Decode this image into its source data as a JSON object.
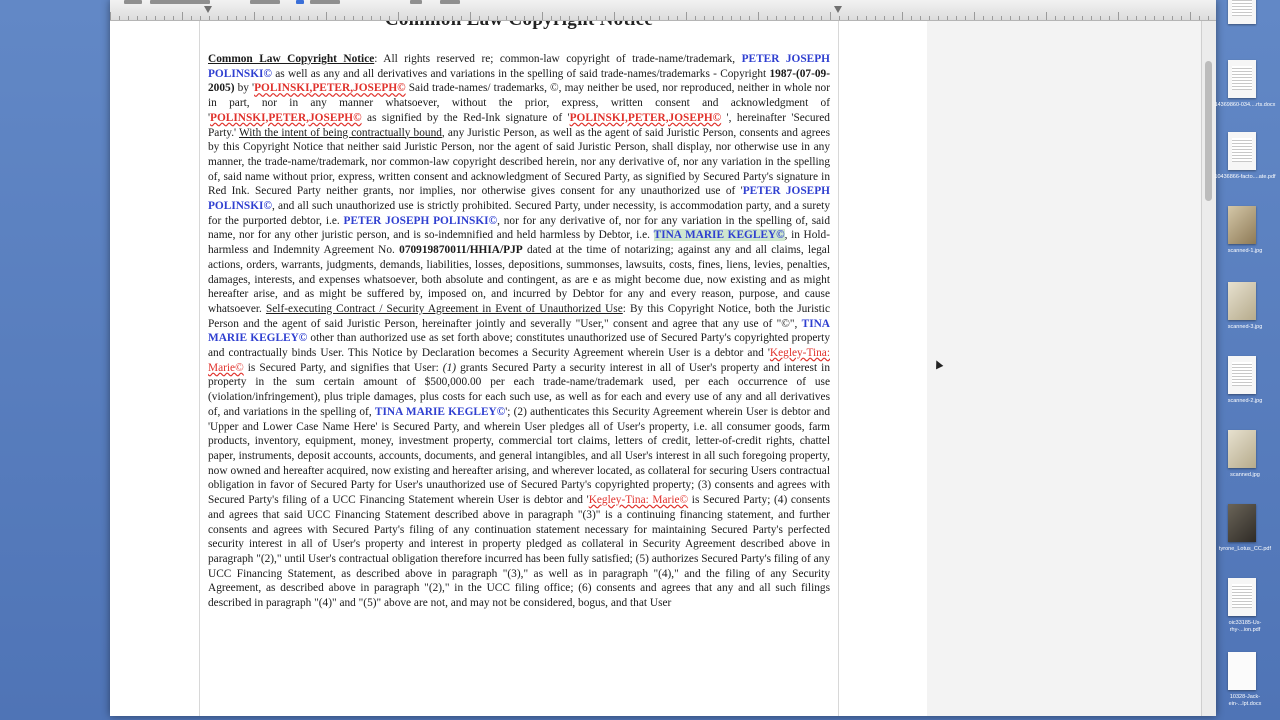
{
  "window": {
    "page_heading": "Common Law Copyright Notice"
  },
  "document": {
    "segments": [
      {
        "t": "Common Law Copyright Notice",
        "c": "heading"
      },
      {
        "t": ": All rights reserved re; common-law copyright of trade-name/trademark, "
      },
      {
        "t": "PETER JOSEPH POLINSKI©",
        "c": "blue"
      },
      {
        "t": " as well as any and all derivatives and variations in the spelling of said trade-names/trademarks - Copyright "
      },
      {
        "t": "1987-(07-09-2005)",
        "c": "bold"
      },
      {
        "t": " by '"
      },
      {
        "t": "POLINSKI,PETER,JOSEPH©",
        "c": "red bold"
      },
      {
        "t": " Said trade-names/ trademarks, ©, may neither be used, nor reproduced, neither in whole nor in part, nor in any manner whatsoever, without the prior, express, written consent and acknowledgment of '"
      },
      {
        "t": "POLINSKI,PETER,JOSEPH©",
        "c": "red bold"
      },
      {
        "t": " as signified by the Red-Ink signature of '"
      },
      {
        "t": "POLINSKI,PETER,JOSEPH©",
        "c": "red bold"
      },
      {
        "t": " ', hereinafter 'Secured Party.' "
      },
      {
        "t": "With the intent of being contractually bound",
        "c": "ul"
      },
      {
        "t": ", any Juristic Person, as well as the agent of said Juristic Person, consents and agrees by this Copyright Notice that neither said Juristic Person, nor the agent of said Juristic Person, shall display, nor otherwise use in any manner, the trade-name/trademark, nor common-law copyright described herein, nor any derivative of, nor any variation in the spelling of, said name without prior, express, written consent and acknowledgment of Secured Party, as signified by Secured Party's signature in Red Ink. Secured Party neither grants, nor implies, nor otherwise gives consent for any unauthorized use of '"
      },
      {
        "t": "PETER JOSEPH POLINSKI©",
        "c": "blue"
      },
      {
        "t": ", and all such unauthorized use is strictly prohibited. Secured Party, under necessity, is accommodation party, and a surety for the purported debtor, i.e. "
      },
      {
        "t": "PETER JOSEPH POLINSKI©",
        "c": "blue"
      },
      {
        "t": ", nor for any derivative of, nor for any variation in the spelling of, said name, nor for any other juristic person, and is so-indemnified and held harmless by Debtor, i.e. "
      },
      {
        "t": "TINA MARIE KEGLEY©",
        "c": "blue hl"
      },
      {
        "t": ", in Hold-harmless and Indemnity Agreement No. "
      },
      {
        "t": "070919870011/HHIA/PJP",
        "c": "bold"
      },
      {
        "t": " dated at the time of notarizing; against any and all claims, legal actions, orders, warrants, judgments, demands, liabilities, losses, depositions, summonses, lawsuits, costs, fines, liens, levies, penalties, damages, interests, and expenses whatsoever, both absolute and contingent, as are e as might become due, now existing and as might hereafter arise, and as might be suffered by, imposed on, and incurred by Debtor for any and every reason, purpose, and cause whatsoever. "
      },
      {
        "t": "Self-executing Contract / Security Agreement in Event of Unauthorized Use",
        "c": "ul"
      },
      {
        "t": ": By this Copyright Notice, both the Juristic Person and the agent of said Juristic Person, hereinafter jointly and severally \"User,\" consent and agree that any use of \"©\", "
      },
      {
        "t": "TINA MARIE KEGLEY©",
        "c": "blue"
      },
      {
        "t": " other than authorized use as set forth above; constitutes unauthorized use of Secured Party's copyrighted property and contractually binds User. This Notice by Declaration becomes a Security Agreement wherein User is a debtor and '"
      },
      {
        "t": "Kegley-Tina: Marie©",
        "c": "red"
      },
      {
        "t": " is Secured Party, and signifies that User: "
      },
      {
        "t": "(1)",
        "c": "ital"
      },
      {
        "t": " grants Secured Party a security interest in all of User's property and interest in property in the sum certain amount of $500,000.00 per each trade-name/trademark used, per each occurrence of use (violation/infringement), plus triple damages, plus costs for each such use, as well as for each and every use of any and all derivatives of, and variations in the spelling of, "
      },
      {
        "t": "TINA MARIE KEGLEY©",
        "c": "blue"
      },
      {
        "t": "'; (2) authenticates this Security Agreement wherein User is debtor and 'Upper and Lower Case Name Here' is Secured Party, and wherein User pledges all of User's property, i.e. all consumer goods, farm products, inventory, equipment, money, investment property, commercial tort claims, letters of credit, letter-of-credit rights, chattel paper, instruments, deposit accounts, accounts, documents, and general intangibles, and all User's interest in all such foregoing property, now owned and hereafter acquired, now existing and hereafter arising, and wherever located, as collateral for securing Users contractual obligation in favor of Secured Party for User's unauthorized use of Secured Party's copyrighted property; (3) consents and agrees with Secured Party's filing of a UCC Financing Statement wherein User is debtor and '"
      },
      {
        "t": "Kegley-Tina: Marie©",
        "c": "red"
      },
      {
        "t": " is Secured Party; (4) consents and agrees that said UCC Financing Statement described above in paragraph \"(3)\" is a continuing financing statement, and further consents and agrees with Secured Party's filing of any continuation statement necessary for maintaining Secured Party's perfected security interest in all of User's property and interest in property pledged as collateral in Security Agreement described above in paragraph \"(2),\" until User's contractual obligation therefore incurred has been fully satisfied; (5) authorizes Secured Party's filing of any UCC Financing Statement, as described above in paragraph \"(3),\" as well as in paragraph \"(4),\" and the filing of any Security Agreement, as described above in paragraph \"(2),\" in the UCC filing office; (6) consents and agrees that any and all such filings described in paragraph \"(4)\" and \"(5)\" above are not, and may not be considered, bogus, and that User"
      }
    ]
  },
  "desktop_icons": [
    {
      "label": "",
      "kind": "doc"
    },
    {
      "label": "14369860-034....rts.docx",
      "kind": "doc"
    },
    {
      "label": "10436866-facto....ate.pdf",
      "kind": "doc"
    },
    {
      "label": "scanned-1.jpg",
      "kind": "photo"
    },
    {
      "label": "scanned-3.jpg",
      "kind": "photo2"
    },
    {
      "label": "scanned-2.jpg",
      "kind": "doc"
    },
    {
      "label": "scanned.jpg",
      "kind": "photo2"
    },
    {
      "label": "tyrone_Lotus_CC.pdf",
      "kind": "dark"
    },
    {
      "label": "oic33185-Us-rhy-...ion.pdf",
      "kind": "doc"
    },
    {
      "label": "10328-Jack-ein-...lpt.docx",
      "kind": "plain"
    }
  ]
}
